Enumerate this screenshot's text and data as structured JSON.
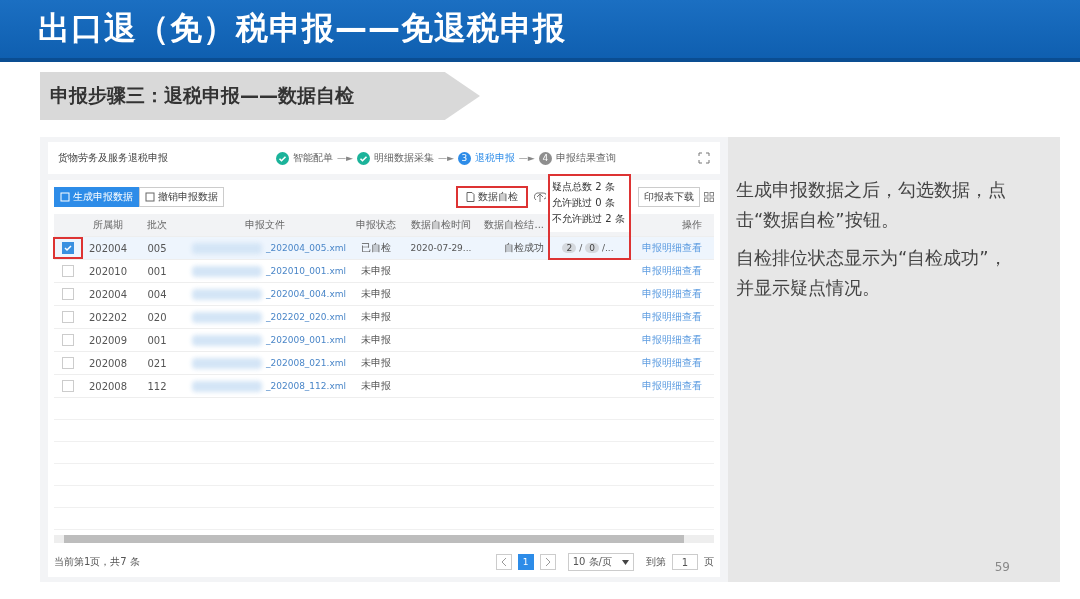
{
  "slide_title": "出口退（免）税申报——免退税申报",
  "step_banner": "申报步骤三：退税申报——数据自检",
  "app": {
    "title": "货物劳务及服务退税申报",
    "steps": [
      {
        "label": "智能配单",
        "done": true,
        "active": false
      },
      {
        "label": "明细数据采集",
        "done": true,
        "active": false
      },
      {
        "number": "3",
        "label": "退税申报",
        "done": false,
        "active": true
      },
      {
        "number": "4",
        "label": "申报结果查询",
        "done": false,
        "active": false
      }
    ],
    "arrow": "—►",
    "left_buttons": [
      {
        "label": "生成申报数据",
        "primary": true
      },
      {
        "label": "撤销申报数据",
        "primary": false
      }
    ],
    "check_button": "数据自检",
    "print_button": "印报表下载",
    "columns": [
      "所属期",
      "批次",
      "申报文件",
      "申报状态",
      "数据自检时间",
      "数据自检结...",
      "",
      "操作"
    ],
    "rows": [
      {
        "checked": true,
        "selected": true,
        "period": "202004",
        "batch": "005",
        "file": "_202004_005.xml",
        "status": "已自检",
        "time": "2020-07-29...",
        "result": "自检成功",
        "doubts": [
          {
            "kind": "badge",
            "text": "2"
          },
          {
            "kind": "sep",
            "text": "/"
          },
          {
            "kind": "badge",
            "text": "0"
          },
          {
            "kind": "sep",
            "text": "/..."
          }
        ],
        "action": "申报明细查看"
      },
      {
        "checked": false,
        "selected": false,
        "period": "202010",
        "batch": "001",
        "file": "_202010_001.xml",
        "status": "未申报",
        "action": "申报明细查看"
      },
      {
        "checked": false,
        "selected": false,
        "period": "202004",
        "batch": "004",
        "file": "_202004_004.xml",
        "status": "未申报",
        "action": "申报明细查看"
      },
      {
        "checked": false,
        "selected": false,
        "period": "202202",
        "batch": "020",
        "file": "_202202_020.xml",
        "status": "未申报",
        "action": "申报明细查看"
      },
      {
        "checked": false,
        "selected": false,
        "period": "202009",
        "batch": "001",
        "file": "_202009_001.xml",
        "status": "未申报",
        "action": "申报明细查看"
      },
      {
        "checked": false,
        "selected": false,
        "period": "202008",
        "batch": "021",
        "file": "_202008_021.xml",
        "status": "未申报",
        "action": "申报明细查看"
      },
      {
        "checked": false,
        "selected": false,
        "period": "202008",
        "batch": "112",
        "file": "_202008_112.xml",
        "status": "未申报",
        "action": "申报明细查看"
      }
    ],
    "popover": [
      "疑点总数 2 条",
      "允许跳过 0 条",
      "不允许跳过 2 条"
    ],
    "footer": {
      "summary": "当前第1页，共7 条",
      "pages": [
        {
          "label": "1",
          "selected": true
        }
      ],
      "page_size": "10 条/页",
      "goto_label": "到第",
      "goto_value": "1",
      "page_unit": "页"
    }
  },
  "notes": [
    "生成申报数据之后，勾选数据，点击“数据自检”按钮。",
    "自检排位状态显示为“自检成功”，并显示疑点情况。"
  ],
  "page_number": "59"
}
